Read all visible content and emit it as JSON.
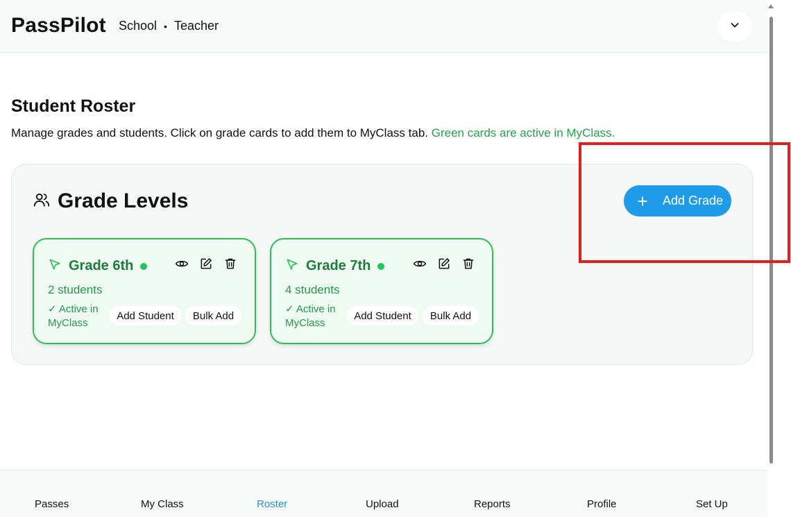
{
  "header": {
    "brand": "PassPilot",
    "school": "School",
    "separator": "•",
    "role": "Teacher"
  },
  "roster": {
    "title": "Student Roster",
    "description": "Manage grades and students. Click on grade cards to add them to MyClass tab.",
    "description_highlight": "Green cards are active in MyClass."
  },
  "grade_levels": {
    "title": "Grade Levels",
    "add_button": "Add Grade",
    "cards": [
      {
        "name": "Grade 6th",
        "count": "2 students",
        "status_line1": "✓ Active in",
        "status_line2": "MyClass",
        "add_student": "Add Student",
        "bulk_add": "Bulk Add"
      },
      {
        "name": "Grade 7th",
        "count": "4 students",
        "status_line1": "✓ Active in",
        "status_line2": "MyClass",
        "add_student": "Add Student",
        "bulk_add": "Bulk Add"
      }
    ]
  },
  "nav": {
    "items": [
      "Passes",
      "My Class",
      "Roster",
      "Upload",
      "Reports",
      "Profile",
      "Set Up"
    ],
    "active": "Roster"
  },
  "colors": {
    "accent": "#1e9be9",
    "active_green": "#22a447",
    "card_border": "#2ebd57",
    "highlight": "#e01e1e"
  }
}
